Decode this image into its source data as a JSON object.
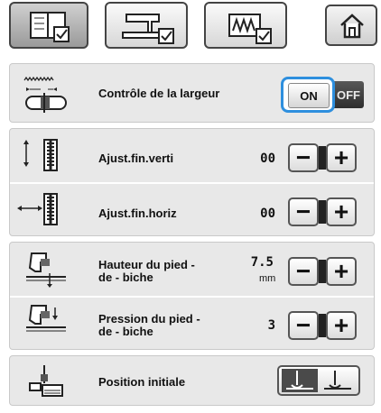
{
  "tabs": [
    {
      "icon": "manual-book-icon",
      "active": true
    },
    {
      "icon": "sewing-machine-icon",
      "active": false
    },
    {
      "icon": "stitch-pattern-icon",
      "active": false
    }
  ],
  "home": {
    "icon": "home-icon"
  },
  "settings": {
    "width_control": {
      "label": "Contrôle de la largeur",
      "on_label": "ON",
      "off_label": "OFF",
      "state": "on",
      "icon": "width-control-icon"
    },
    "fine_vertical": {
      "label": "Ajust.fin.verti",
      "value": "00",
      "icon": "vertical-adjust-icon"
    },
    "fine_horizontal": {
      "label": "Ajust.fin.horiz",
      "value": "00",
      "icon": "horizontal-adjust-icon"
    },
    "presser_height": {
      "label_line1": "Hauteur du pied -",
      "label_line2": "de - biche",
      "value": "7.5",
      "unit": "mm",
      "icon": "presser-foot-height-icon"
    },
    "presser_pressure": {
      "label_line1": "Pression du pied -",
      "label_line2": "de - biche",
      "value": "3",
      "icon": "presser-foot-pressure-icon"
    },
    "initial_position": {
      "label": "Position initiale",
      "icon": "needle-position-icon"
    }
  },
  "stepper": {
    "minus": "−",
    "plus": "+"
  },
  "colors": {
    "highlight": "#2e8fde",
    "panel": "#e8e8e8"
  }
}
